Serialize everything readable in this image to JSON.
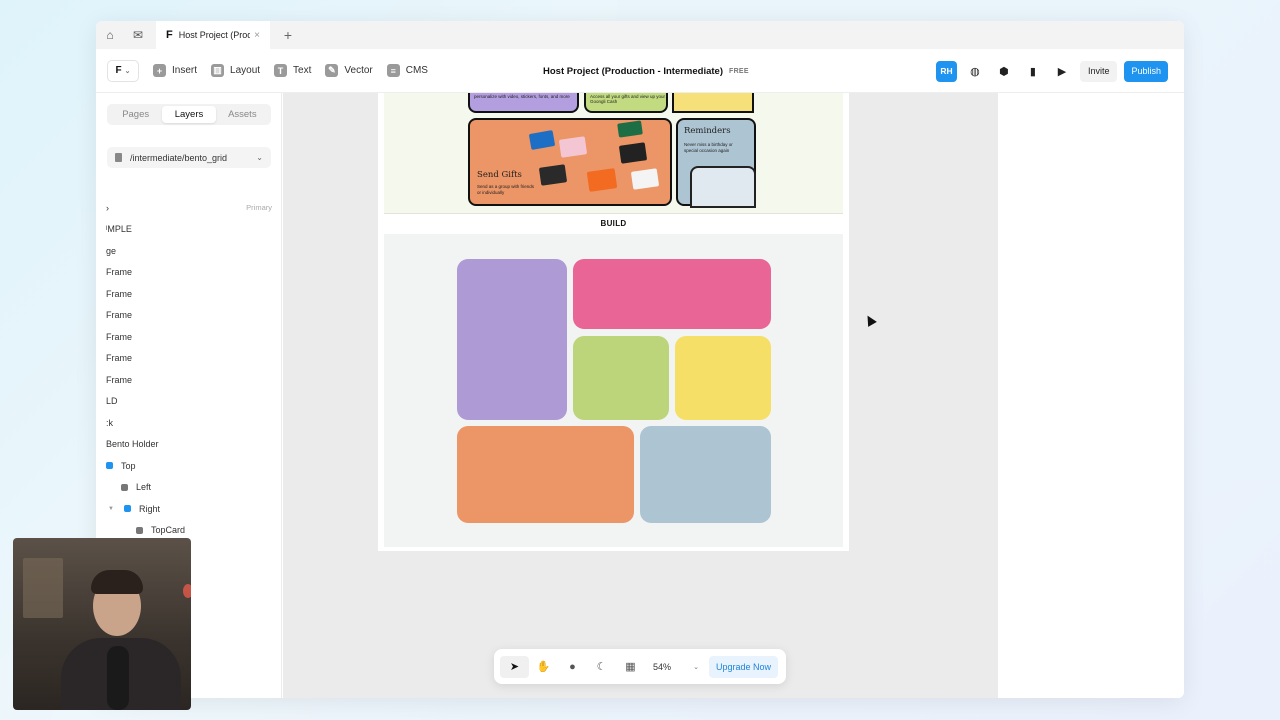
{
  "tabbar": {
    "doc_tab_title": "Host Project (Prod.",
    "new_tab": "+",
    "close": "×"
  },
  "toolbar": {
    "framer_logo": "F",
    "tools": [
      {
        "label": "Insert",
        "icon": "plus-icon"
      },
      {
        "label": "Layout",
        "icon": "layout-icon"
      },
      {
        "label": "Text",
        "icon": "text-icon"
      },
      {
        "label": "Vector",
        "icon": "pen-icon"
      },
      {
        "label": "CMS",
        "icon": "database-icon"
      }
    ],
    "doc_title": "Host Project (Production - Intermediate)",
    "plan_badge": "FREE",
    "avatar_initials": "RH",
    "invite_label": "Invite",
    "publish_label": "Publish"
  },
  "leftpanel": {
    "tabs": [
      "Pages",
      "Layers",
      "Assets"
    ],
    "active_tab": "Layers",
    "path": "/intermediate/bento_grid",
    "layers": [
      {
        "label": "›",
        "note": "Primary"
      },
      {
        "label": "ˡMPLE"
      },
      {
        "label": "ge"
      },
      {
        "label": "Frame"
      },
      {
        "label": "Frame"
      },
      {
        "label": "Frame"
      },
      {
        "label": "Frame"
      },
      {
        "label": "Frame"
      },
      {
        "label": "Frame"
      },
      {
        "label": "LD"
      },
      {
        "label": ":k"
      },
      {
        "label": "Bento Holder"
      },
      {
        "label": "Top"
      },
      {
        "label": "Left"
      },
      {
        "label": "Right"
      },
      {
        "label": "TopCard"
      }
    ]
  },
  "canvas": {
    "section_label": "BUILD",
    "preview_texts": {
      "send_gifts": "Send Gifts",
      "send_gifts_desc": "Send as a group with friends or individually",
      "reminders": "Reminders",
      "reminders_desc": "Never miss a birthday or special occasion again",
      "top_left_desc": "personalize with video, stickers, fonts, and more",
      "top_mid_desc": "Access all your gifts and view up your Goongli Cash"
    },
    "bento_colors": {
      "purple": "#ae9bd6",
      "pink": "#e86595",
      "green": "#bcd47a",
      "yellow": "#f6df66",
      "orange": "#ec9566",
      "blue": "#adc4d2"
    }
  },
  "bottombar": {
    "zoom": "54%",
    "upgrade_label": "Upgrade Now"
  }
}
